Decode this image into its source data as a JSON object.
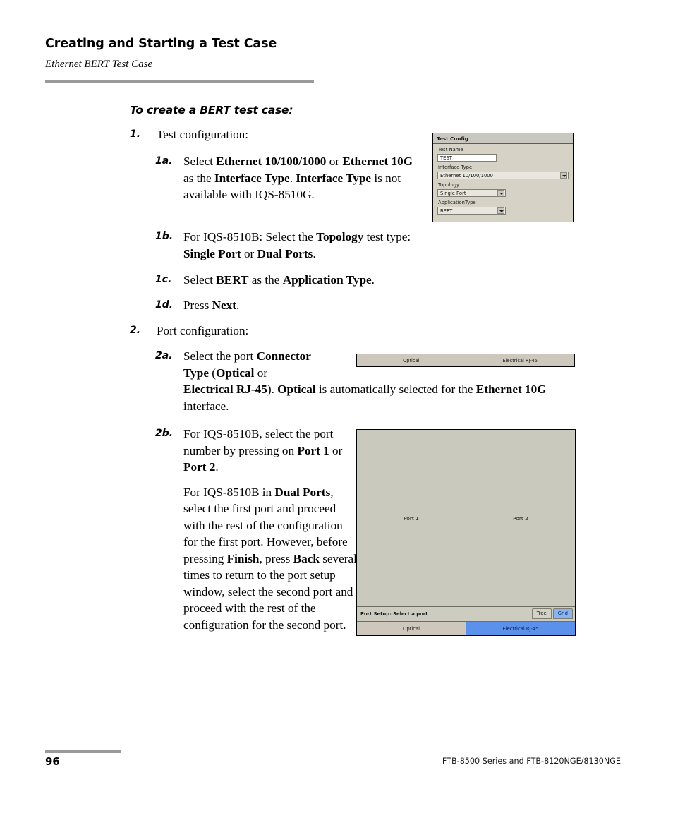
{
  "header": {
    "chapter_title": "Creating and Starting a Test Case",
    "section_title": "Ethernet BERT Test Case"
  },
  "procedure": {
    "heading": "To create a BERT test case:",
    "steps": [
      {
        "num": "1.",
        "text": "Test configuration:"
      },
      {
        "num": "1a.",
        "text": "Select Ethernet 10/100/1000 or Ethernet 10G as the Interface Type. Interface Type is not available with IQS-8510G."
      },
      {
        "num": "1b.",
        "text": "For IQS-8510B: Select the Topology test type: Single Port or Dual Ports."
      },
      {
        "num": "1c.",
        "text": "Select BERT as the Application Type."
      },
      {
        "num": "1d.",
        "text": "Press Next."
      },
      {
        "num": "2.",
        "text": "Port configuration:"
      },
      {
        "num": "2a.",
        "text": "Select the port Connector Type (Optical or Electrical RJ-45). Optical is automatically selected for the Ethernet 10G interface."
      },
      {
        "num": "2b.",
        "text": "For IQS-8510B, select the port number by pressing on Port 1 or Port 2."
      },
      {
        "num": "2b-2",
        "text": "For IQS-8510B in Dual Ports, select the first port and proceed with the rest of the configuration for the first port. However, before pressing Finish, press Back several times to return to the port setup window, select the second port and proceed with the rest of the configuration for the second port."
      }
    ]
  },
  "test_config_dialog": {
    "title": "Test Config",
    "fields": [
      {
        "label": "Test Name",
        "value": "TEST",
        "type": "text"
      },
      {
        "label": "Interface Type",
        "value": "Ethernet 10/100/1000",
        "type": "combo-wide"
      },
      {
        "label": "Topology",
        "value": "Single Port",
        "type": "combo-narrow"
      },
      {
        "label": "ApplicationType",
        "value": "BERT",
        "type": "combo-narrow"
      }
    ]
  },
  "connector_tabs": {
    "optical": "Optical",
    "electrical": "Electrical RJ-45"
  },
  "port_setup": {
    "port1": "Port 1",
    "port2": "Port 2",
    "status": "Port Setup: Select a port",
    "view_tree": "Tree",
    "view_grid": "Grid",
    "optical": "Optical",
    "electrical": "Electrical RJ-45"
  },
  "footer": {
    "page_number": "96",
    "product_line": "FTB-8500 Series and FTB-8120NGE/8130NGE"
  },
  "colors": {
    "rule": "#9a9a9a",
    "dialog_bg": "#d6d3c6",
    "tab_bg": "#cdc8bb",
    "selected_blue": "#5b90eb",
    "panel_bg": "#cac9bd"
  }
}
